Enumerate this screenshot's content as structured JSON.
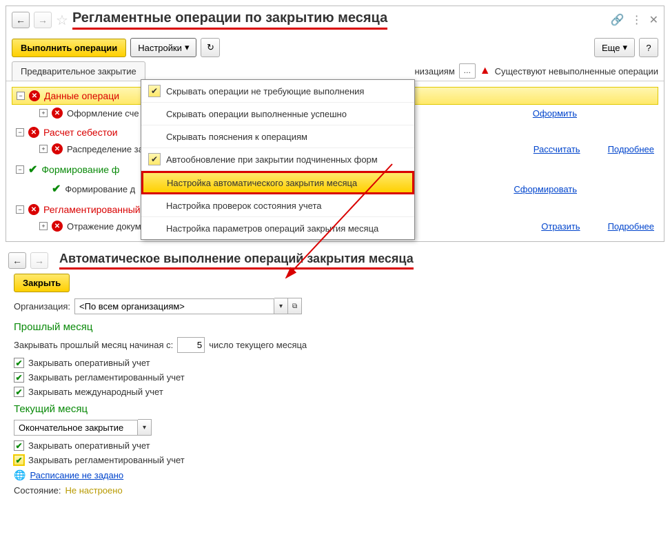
{
  "top": {
    "title": "Регламентные операции по закрытию месяца",
    "execute": "Выполнить операции",
    "settings": "Настройки",
    "more": "Еще",
    "help": "?",
    "tab": "Предварительное закрытие",
    "org_tail": "низациям",
    "warning": "Существуют невыполненные операции"
  },
  "dd": {
    "i0": "Скрывать операции не требующие выполнения",
    "i1": "Скрывать операции выполненные успешно",
    "i2": "Скрывать пояснения к операциям",
    "i3": "Автообновление при закрытии подчиненных форм",
    "i4": "Настройка автоматического закрытия месяца",
    "i5": "Настройка проверок состояния учета",
    "i6": "Настройка параметров операций закрытия месяца"
  },
  "tree": {
    "g0": "Данные операци",
    "l0": "Оформление сче",
    "a0": "Оформить",
    "g1": "Расчет себестои",
    "l1": "Распределение за",
    "a1": "Рассчитать",
    "a1b": "Подробнее",
    "g2": "Формирование ф",
    "l2": "Формирование д",
    "a2": "Сформировать",
    "g3": "Регламентированный учет",
    "l3": "Отражение документов в регламентированном учете",
    "a3": "Отразить",
    "a3b": "Подробнее"
  },
  "bot": {
    "title": "Автоматическое выполнение операций закрытия месяца",
    "close": "Закрыть",
    "org_label": "Организация:",
    "org_value": "<По всем организациям>",
    "sec1": "Прошлый месяц",
    "prev_label_a": "Закрывать прошлый месяц начиная с:",
    "prev_num": "5",
    "prev_label_b": "число текущего месяца",
    "chk1": "Закрывать оперативный учет",
    "chk2": "Закрывать регламентированный учет",
    "chk3": "Закрывать международный учет",
    "sec2": "Текущий месяц",
    "mode": "Окончательное закрытие",
    "chk4": "Закрывать оперативный учет",
    "chk5": "Закрывать регламентированный учет",
    "sched": "Расписание не задано",
    "status_l": "Состояние:",
    "status_v": "Не настроено"
  }
}
